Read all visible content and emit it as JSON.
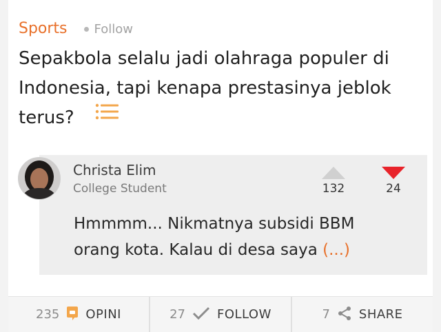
{
  "topic": {
    "name": "Sports",
    "follow_label": "Follow"
  },
  "question": {
    "text": "Sepakbola selalu jadi olahraga populer di Indonesia, tapi kenapa prestasinya jeblok terus?"
  },
  "answer": {
    "author_name": "Christa Elim",
    "author_role": "College Student",
    "upvotes": "132",
    "downvotes": "24",
    "text": "Hmmmm... Nikmatnya subsidi BBM orang kota. Kalau di desa saya ",
    "more_label": "(...)"
  },
  "actions": {
    "opinions": {
      "count": "235",
      "label": "OPINI"
    },
    "follow": {
      "count": "27",
      "label": "FOLLOW"
    },
    "share": {
      "count": "7",
      "label": "SHARE"
    }
  },
  "colors": {
    "accent": "#e8702a",
    "downvote_active": "#e8232a"
  }
}
